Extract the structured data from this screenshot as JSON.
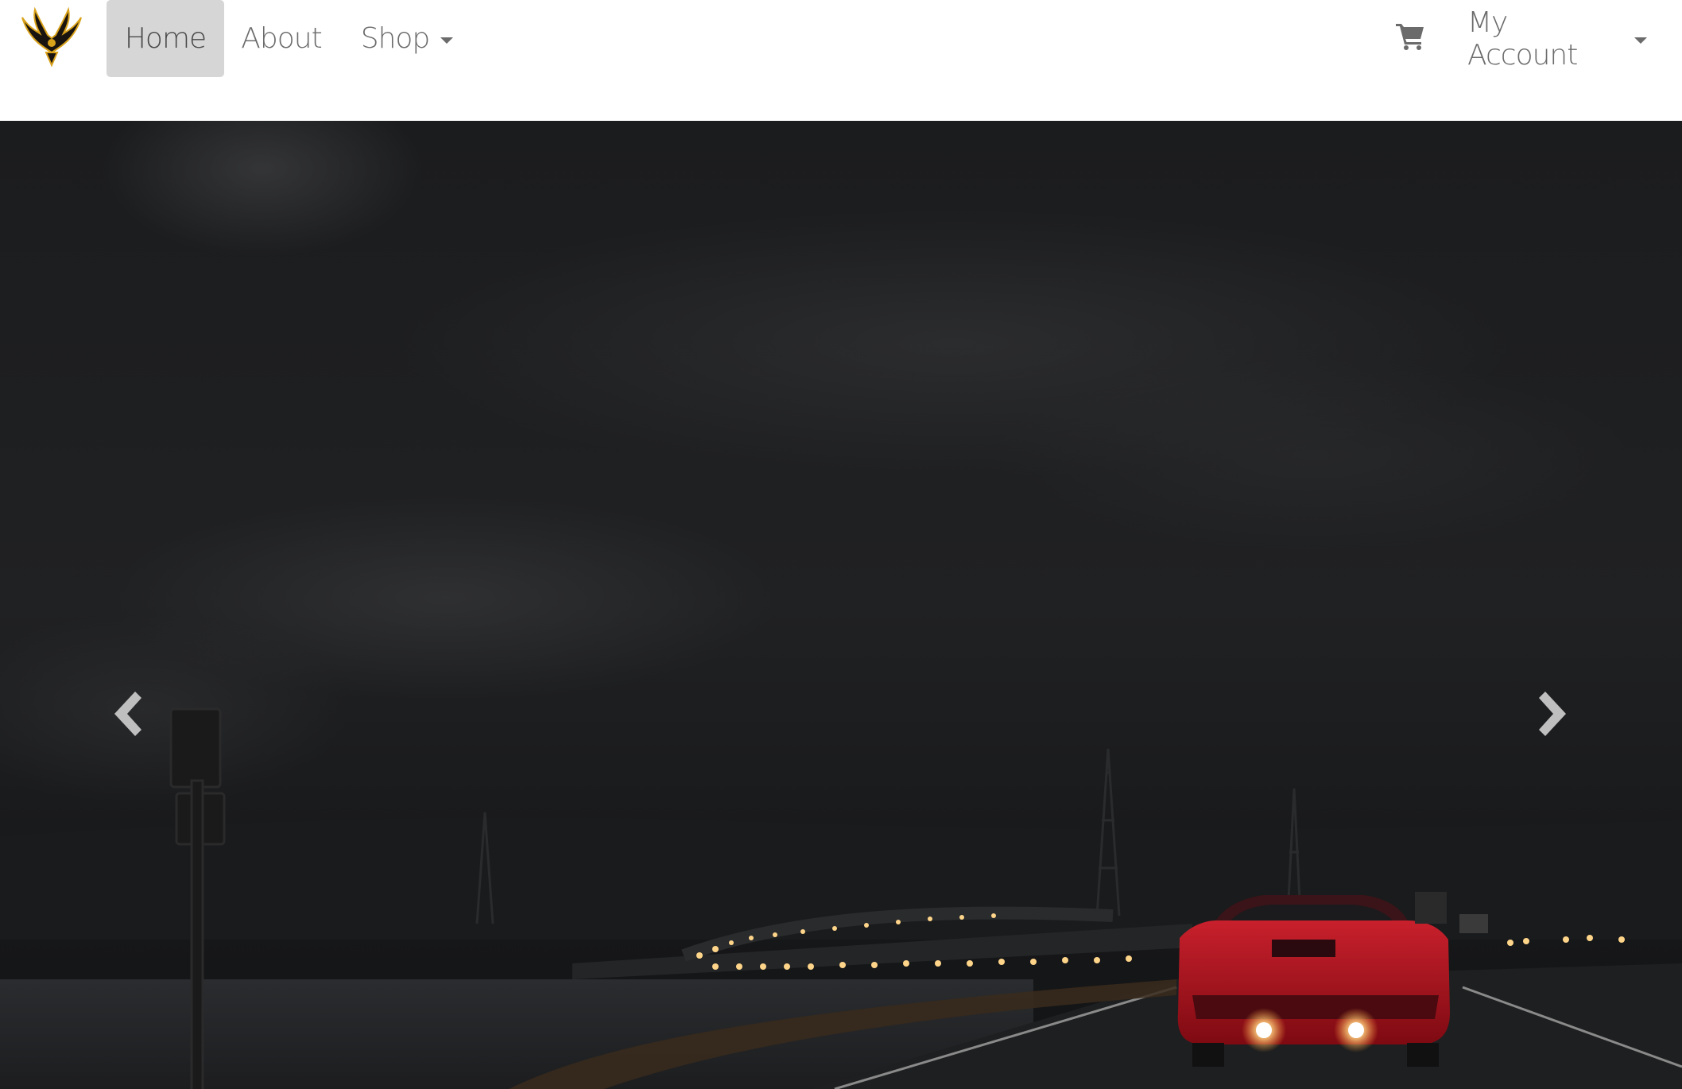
{
  "navbar": {
    "logo_icon": "firebird-logo-icon",
    "items": [
      {
        "label": "Home",
        "active": true
      },
      {
        "label": "About",
        "active": false
      },
      {
        "label": "Shop",
        "active": false,
        "has_dropdown": true
      }
    ],
    "cart_icon": "shopping-cart-icon",
    "account": {
      "label": "My Account",
      "has_dropdown": true
    }
  },
  "carousel": {
    "prev_icon": "chevron-left-icon",
    "next_icon": "chevron-right-icon",
    "active_slide_description": ""
  },
  "colors": {
    "active_nav_bg": "#d6d6d6",
    "nav_text": "#6b6b6b",
    "car_red": "#b0101c",
    "sky_dark": "#151617"
  }
}
